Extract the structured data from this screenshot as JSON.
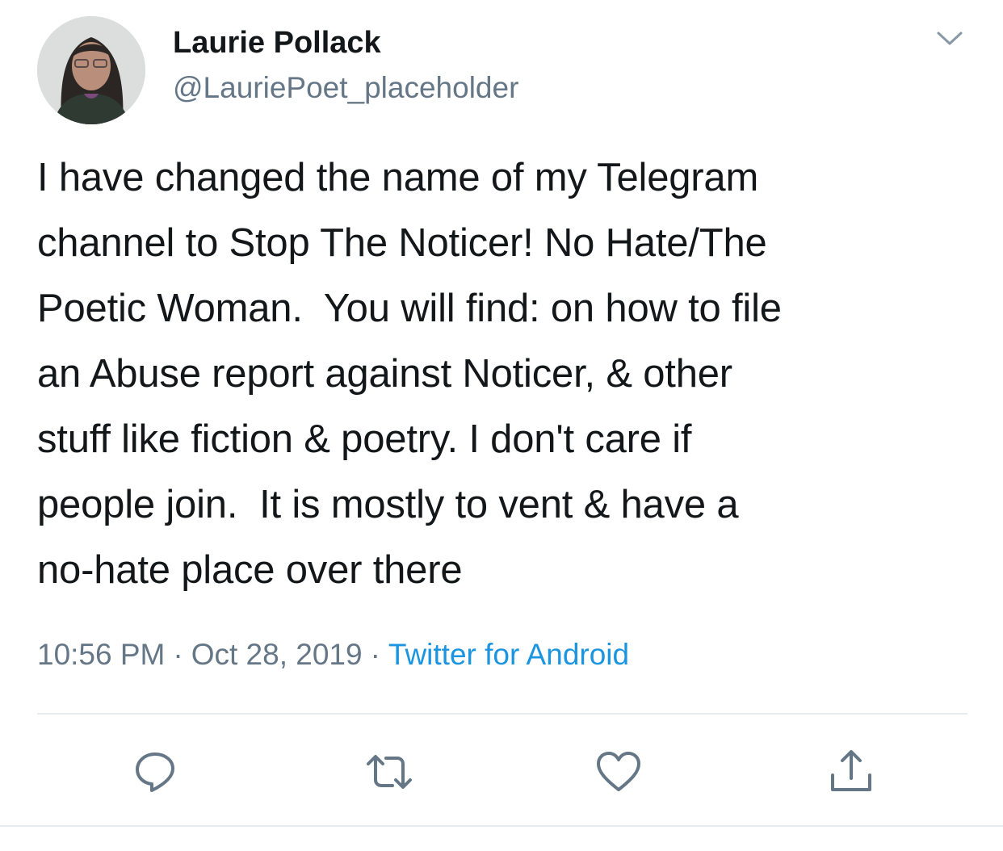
{
  "author": {
    "display_name": "Laurie Pollack",
    "handle": "@LauriePoet_placeholder"
  },
  "tweet": {
    "text": "I have changed the name of my Telegram\nchannel to Stop The Noticer! No Hate/The\nPoetic Woman.  You will find: on how to file\nan Abuse report against Noticer, & other\nstuff like fiction & poetry. I don't care if\npeople join.  It is mostly to vent & have a\nno-hate place over there",
    "time": "10:56 PM",
    "date": "Oct 28, 2019",
    "separator": "·",
    "source": "Twitter for Android"
  },
  "icons": {
    "menu": "chevron-down-icon",
    "reply": "reply-icon",
    "retweet": "retweet-icon",
    "like": "heart-icon",
    "share": "share-icon"
  },
  "colors": {
    "text": "#14171a",
    "secondary": "#657786",
    "link": "#1b95e0",
    "divider": "#e6ecf0"
  }
}
